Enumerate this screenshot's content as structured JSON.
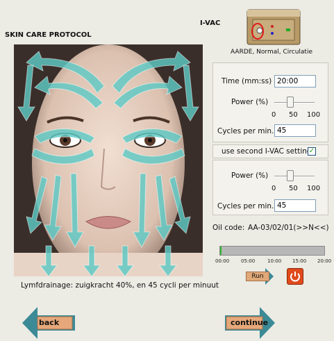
{
  "header": {
    "title": "I-VAC",
    "subtitle": "SKIN CARE PROTOCOL"
  },
  "device": {
    "label": "AARDE, Normal, Circulatie"
  },
  "settings1": {
    "time_label": "Time (mm:ss)",
    "time_value": "20:00",
    "power_label": "Power (%)",
    "power_ticks": [
      "0",
      "50",
      "100"
    ],
    "power_value": 40,
    "cycles_label": "Cycles per min.",
    "cycles_value": "45"
  },
  "second_setting": {
    "label": "use second I-VAC setting",
    "checked": true
  },
  "settings2": {
    "power_label": "Power (%)",
    "power_ticks": [
      "0",
      "50",
      "100"
    ],
    "power_value": 40,
    "cycles_label": "Cycles per min.",
    "cycles_value": "45"
  },
  "oil": {
    "label": "Oil code:",
    "value": "AA-03/02/01(>>N<<)"
  },
  "progress": {
    "value": 0.01,
    "ticks": [
      "00:00",
      "05:00",
      "10:00",
      "15:00",
      "20:00"
    ]
  },
  "controls": {
    "run_label": "Run"
  },
  "caption": "Lymfdrainage: zuigkracht 40%, en 45 cycli per minuut",
  "nav": {
    "back_label": "back",
    "continue_label": "continue"
  },
  "colors": {
    "arrow": "#5ec9c4",
    "button": "#e6a87a",
    "power": "#e04a1c",
    "nav_arrow": "#3b8a96"
  }
}
